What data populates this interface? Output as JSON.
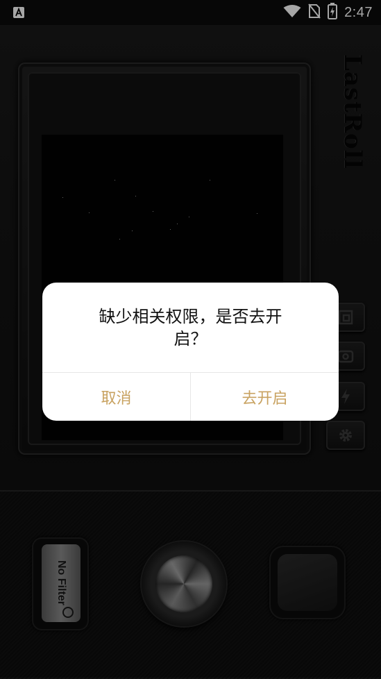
{
  "status_bar": {
    "time": "2:47",
    "icons": [
      "app-notification-icon",
      "wifi-icon",
      "no-sim-icon",
      "battery-charging-icon"
    ]
  },
  "camera": {
    "brand": "LastRoll",
    "side_buttons": [
      "aspect-ratio-icon",
      "switch-camera-icon",
      "flash-icon",
      "settings-gear-icon"
    ],
    "filter_label": "No Filter"
  },
  "dialog": {
    "message": "缺少相关权限，是否去开启？",
    "cancel_label": "取消",
    "confirm_label": "去开启",
    "accent_color": "#c8a260"
  }
}
